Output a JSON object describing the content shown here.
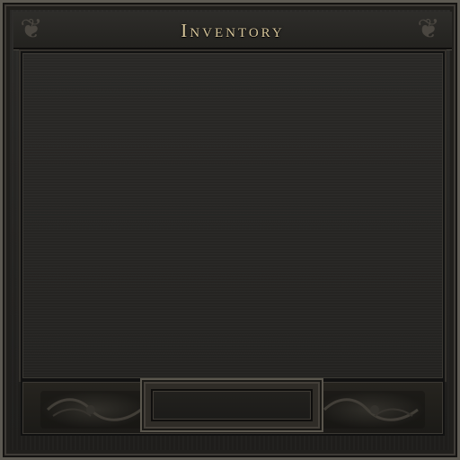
{
  "window": {
    "title": "Inventory"
  },
  "decorations": {
    "corner_icon": "fleur-ornament-icon",
    "corner_glyph": "❦",
    "panel_ornament_icon": "scroll-ornament-icon"
  },
  "content": {
    "items": []
  },
  "footer": {
    "slot": {
      "value": ""
    }
  }
}
